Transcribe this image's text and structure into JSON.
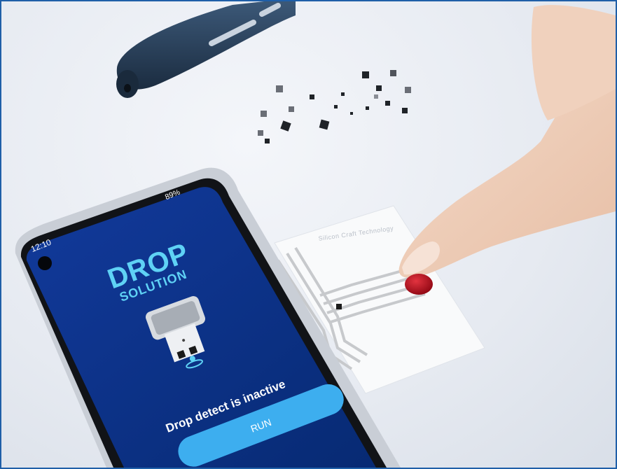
{
  "phone": {
    "status_time": "12:10",
    "status_battery": "89%",
    "app_title": "DROP",
    "app_subtitle": "SOLUTION",
    "status_message": "Drop detect is inactive",
    "run_button": "RUN"
  },
  "sensor": {
    "printed_text": "Silicon Craft Technology"
  },
  "colors": {
    "screen_blue": "#0b2f86",
    "accent_cyan": "#5fd2f5",
    "button_blue": "#3daeef",
    "blood_red": "#b3081a",
    "frame_border": "#1f5fa8"
  }
}
